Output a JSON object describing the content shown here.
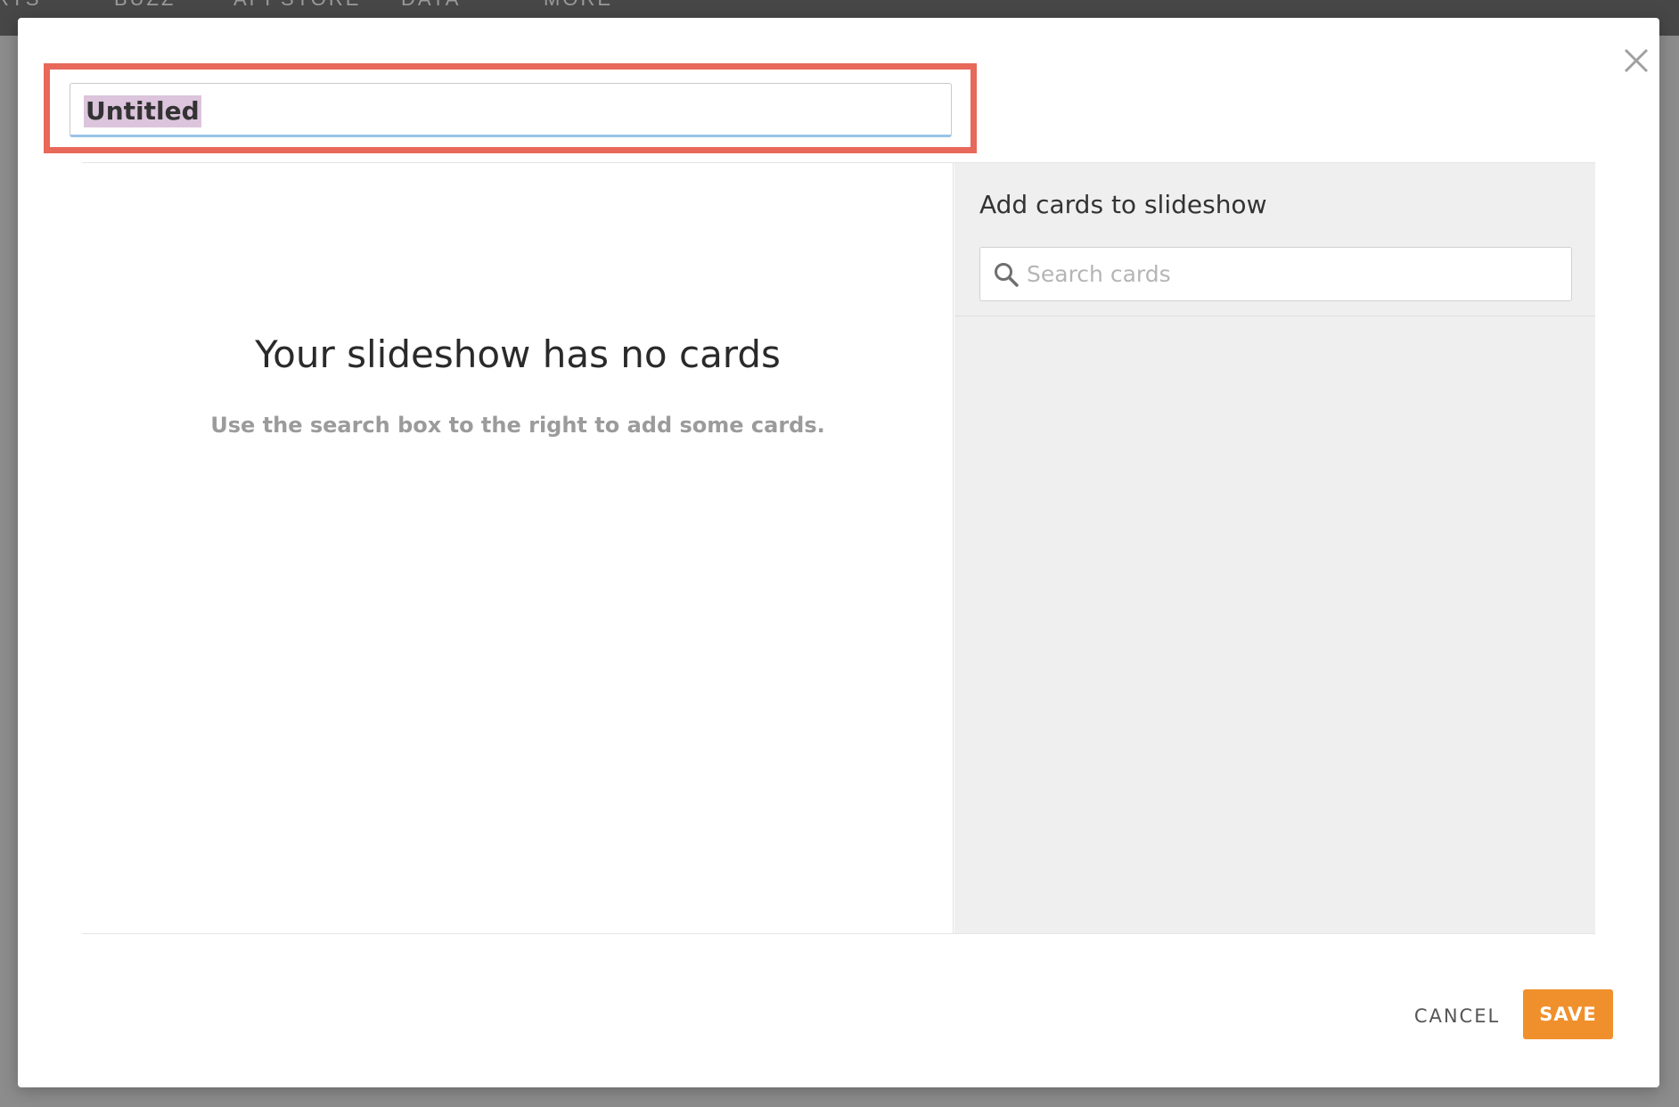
{
  "nav": {
    "items": [
      "RTS",
      "BUZZ",
      "APPSTORE",
      "DATA",
      "MORE"
    ]
  },
  "modal": {
    "title_value": "Untitled",
    "close_icon": "close-icon"
  },
  "empty_state": {
    "title": "Your slideshow has no cards",
    "subtitle": "Use the search box to the right to add some cards."
  },
  "sidebar": {
    "heading": "Add cards to slideshow",
    "search_placeholder": "Search cards",
    "search_icon": "search-icon"
  },
  "footer": {
    "cancel_label": "CANCEL",
    "save_label": "SAVE"
  },
  "colors": {
    "accent": "#f0902c",
    "highlight_border": "#e8685a",
    "selection": "#dcc4dc"
  }
}
